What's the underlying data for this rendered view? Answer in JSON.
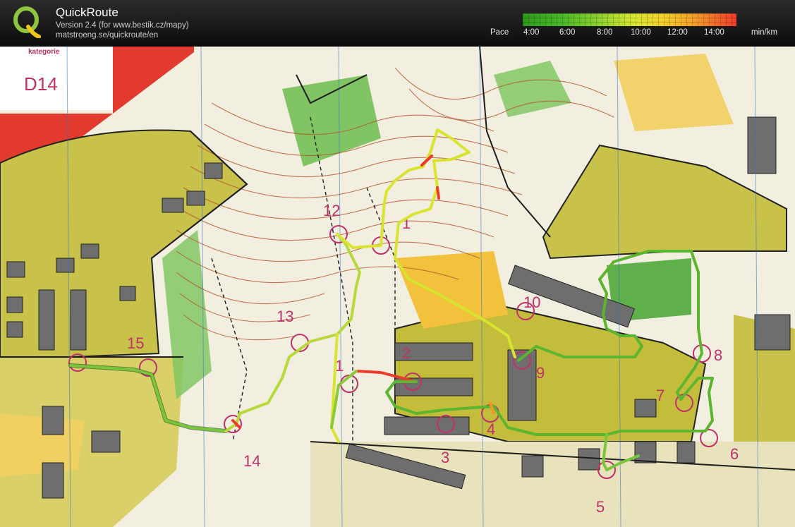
{
  "header": {
    "title": "QuickRoute",
    "version": "Version 2.4  (for www.bestik.cz/mapy)",
    "url": "matstroeng.se/quickroute/en",
    "pace_label": "Pace",
    "pace_ticks": [
      "4:00",
      "6:00",
      "8:00",
      "10:00",
      "12:00",
      "14:00"
    ],
    "pace_unit": "min/km",
    "colors": {
      "fast": "#2e9a1e",
      "medium": "#e8e030",
      "slow": "#ef3a2a"
    }
  },
  "map": {
    "category_label": "kategorie",
    "course_name": "D14",
    "controls": [
      "1",
      "2",
      "3",
      "4",
      "5",
      "6",
      "7",
      "8",
      "9",
      "10",
      "12",
      "13",
      "14",
      "15",
      "1"
    ]
  }
}
